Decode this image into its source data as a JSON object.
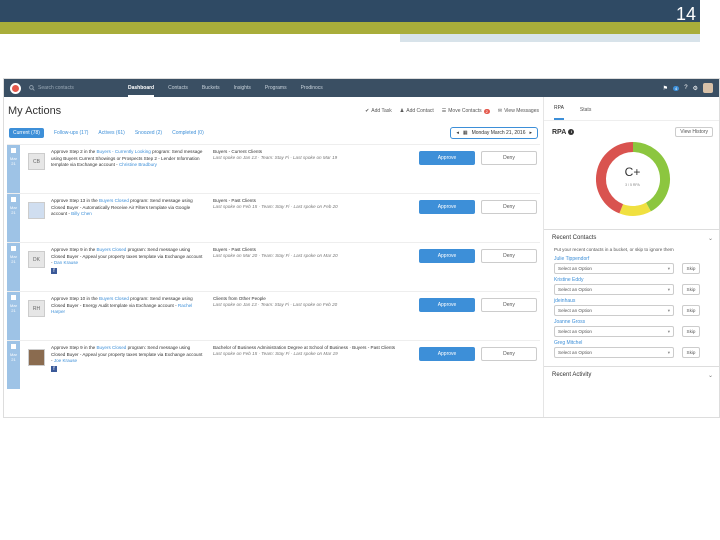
{
  "slide": {
    "number": "14"
  },
  "nav": {
    "search_placeholder": "Search contacts",
    "items": [
      "Dashboard",
      "Contacts",
      "Buckets",
      "Insights",
      "Programs",
      "Prodinocs"
    ],
    "notification_count": "4"
  },
  "actions": {
    "title": "My Actions",
    "toolbar": {
      "add_task": "Add Task",
      "add_contact": "Add Contact",
      "move_contacts": "Move Contacts",
      "move_badge": "2",
      "view_messages": "View Messages"
    },
    "filters": [
      "Current (78)",
      "Follow-ups (17)",
      "Actives (61)",
      "Snoozed (2)",
      "Completed (0)"
    ],
    "date": "Monday March 21, 2016",
    "rows": [
      {
        "month": "Mar",
        "day": "21",
        "initials": "CB",
        "d1": "Approve Step 2 in the ",
        "d1_link": "Buyers - Currently Looking",
        "d2": " program: Send message using Buyers Current Showings or Prospects Step 2 - Lender Information template via Exchange account - ",
        "d2_link": "Christine Bradbury",
        "title": "Buyers - Current Clients",
        "sub": "Last spoke on Jan 13 · Team: Stay Fi · Last spoke on Mar 19",
        "has_fb": false
      },
      {
        "month": "Mar",
        "day": "21",
        "initials": "",
        "d1": "Approve Step 13 in the ",
        "d1_link": "Buyers Closed",
        "d2": " program: Send message using Closed Buyer - Automatically Receive Air Filters template via Google account - ",
        "d2_link": "Billy Chen",
        "title": "Buyers - Past Clients",
        "sub": "Last spoke on Feb 15 · Team: Stay Fi · Last spoke on Feb 20",
        "has_fb": false
      },
      {
        "month": "Mar",
        "day": "21",
        "initials": "DK",
        "d1": "Approve Step 9 in the ",
        "d1_link": "Buyers Closed",
        "d2": " program: Send message using Closed Buyer - Appeal your property taxes template via Exchange account - ",
        "d2_link": "Dan Krause",
        "title": "Buyers - Past Clients",
        "sub": "Last spoke on Mar 20 · Team: Stay Fi · Last spoke on Mar 20",
        "has_fb": true
      },
      {
        "month": "Mar",
        "day": "21",
        "initials": "RH",
        "d1": "Approve Step 10 in the ",
        "d1_link": "Buyers Closed",
        "d2": " program: Send message using Closed Buyer - Energy Audit template via Exchange account - ",
        "d2_link": "Rachel Harper",
        "title": "Clients from Other People",
        "sub": "Last spoke on Jan 13 · Team: Stay Fi · Last spoke on Feb 20",
        "has_fb": false
      },
      {
        "month": "Mar",
        "day": "21",
        "initials": "",
        "d1": "Approve Step 9 in the ",
        "d1_link": "Buyers Closed",
        "d2": " program: Send message using Closed Buyer - Appeal your property taxes template via Exchange account - ",
        "d2_link": "Joe Krause",
        "title": "Bachelor of Business Administration Degree at School of Business · Buyers - Past Clients",
        "sub": "Last spoke on Feb 15 · Team: Stay Fi · Last spoke on Mar 19",
        "has_fb": true
      }
    ],
    "approve_label": "Approve",
    "deny_label": "Deny"
  },
  "right": {
    "tabs": [
      "RPA",
      "Stats"
    ],
    "rpa_title": "RPA",
    "view_history": "View History",
    "grade": "C+",
    "grade_sub": "3 / 5 RPA",
    "donut": {
      "green": 0.42,
      "yellow": 0.14,
      "red": 0.44
    },
    "recent_contacts_title": "Recent Contacts",
    "recent_hint": "Put your recent contacts in a bucket, or skip to ignore them",
    "contacts": [
      "Julie Tippendorf",
      "Kristine Eddy",
      "jdeinhaus",
      "Joanne Gross",
      "Greg Mitchel"
    ],
    "select_placeholder": "Select an Option",
    "skip_label": "Skip",
    "recent_activity_title": "Recent Activity"
  }
}
